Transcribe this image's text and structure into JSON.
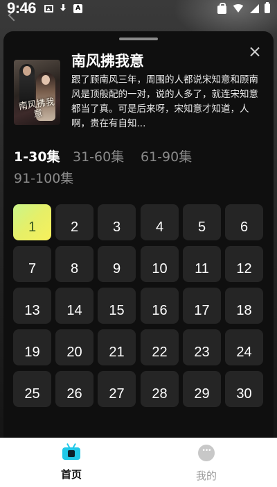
{
  "status_bar": {
    "time": "9:46",
    "left_icons": [
      "image-icon",
      "download-icon",
      "app-a-icon"
    ],
    "right_icons": [
      "shopping-bag-icon",
      "wifi-icon",
      "signal-icon",
      "battery-icon"
    ]
  },
  "drama": {
    "title": "南风拂我意",
    "cover_text": "南风拂我意",
    "description": "跟了顾南风三年，周围的人都说宋知意和顾南风是顶般配的一对，说的人多了，就连宋知意都当了真。可是后来呀，宋知意才知道，人啊，贵在有自知..."
  },
  "range_tabs": [
    {
      "label": "1-30集",
      "active": true
    },
    {
      "label": "31-60集",
      "active": false
    },
    {
      "label": "61-90集",
      "active": false
    },
    {
      "label": "91-100集",
      "active": false
    }
  ],
  "episodes": [
    "1",
    "2",
    "3",
    "4",
    "5",
    "6",
    "7",
    "8",
    "9",
    "10",
    "11",
    "12",
    "13",
    "14",
    "15",
    "16",
    "17",
    "18",
    "19",
    "20",
    "21",
    "22",
    "23",
    "24",
    "25",
    "26",
    "27",
    "28",
    "29",
    "30"
  ],
  "active_episode": "1",
  "colors": {
    "sheet_bg": "#0f0f0f",
    "tile_bg": "#252525",
    "active_tile_gradient": [
      "#c9f58a",
      "#f7f05c"
    ],
    "nav_active_icon": "#21c8e8"
  },
  "bottom_nav": [
    {
      "label": "首页",
      "icon": "tv-icon",
      "active": true
    },
    {
      "label": "我的",
      "icon": "profile-icon",
      "active": false
    }
  ]
}
